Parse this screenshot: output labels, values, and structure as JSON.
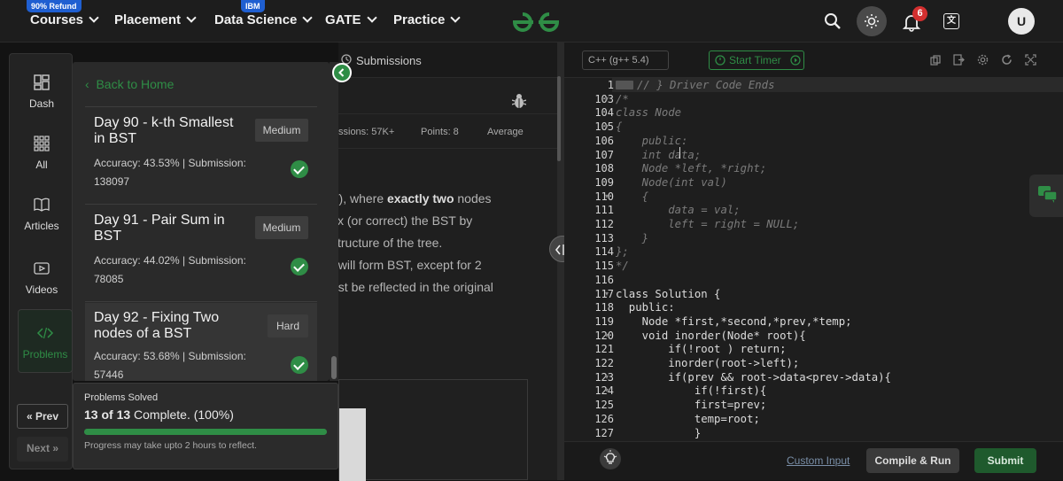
{
  "nav": {
    "courses": "Courses",
    "courses_badge": "90% Refund",
    "placement": "Placement",
    "data_science": "Data Science",
    "data_science_badge": "IBM",
    "gate": "GATE",
    "practice": "Practice",
    "notification_count": "6",
    "avatar_initial": "U"
  },
  "rail": {
    "items": [
      {
        "label": "Dash",
        "icon": "dashboard-icon"
      },
      {
        "label": "All",
        "icon": "grid-icon"
      },
      {
        "label": "Articles",
        "icon": "book-icon"
      },
      {
        "label": "Videos",
        "icon": "play-icon"
      },
      {
        "label": "Problems",
        "icon": "code-icon"
      }
    ],
    "prev": "Prev",
    "next": "Next"
  },
  "problem_list": {
    "back": "Back to Home",
    "cards": [
      {
        "title": "Day 90 - k-th Smallest in BST",
        "difficulty": "Medium",
        "stats_line1": "Accuracy: 43.53% | Submission:",
        "stats_line2": "138097"
      },
      {
        "title": "Day 91 - Pair Sum in BST",
        "difficulty": "Medium",
        "stats_line1": "Accuracy: 44.02% | Submission:",
        "stats_line2": "78085"
      },
      {
        "title": "Day 92 - Fixing Two nodes of a BST",
        "difficulty": "Hard",
        "stats_line1": "Accuracy: 53.68% | Submission:",
        "stats_line2": "57446"
      }
    ]
  },
  "progress": {
    "heading": "Problems Solved",
    "count": "13 of 13",
    "complete_text": "Complete. (100%)",
    "fraction": 1.0,
    "note": "Progress may take upto 2 hours to reflect."
  },
  "middle": {
    "submissions_tab": "Submissions",
    "stat_submissions": "ssions: 57K+",
    "stat_points": "Points: 8",
    "stat_average": "Average",
    "desc_lines": [
      "T), where exactly two nodes",
      "fix (or correct) the BST by",
      "structure of the tree.",
      "t will form BST, except for 2",
      "ust be reflected in the original"
    ],
    "bold_phrase": "exactly two"
  },
  "editor": {
    "language": "C++ (g++ 5.4)",
    "start_timer": "Start Timer",
    "custom_input": "Custom Input",
    "compile_run": "Compile & Run",
    "submit": "Submit",
    "lines": [
      {
        "n": "1",
        "code": "// } Driver Code Ends",
        "comment": true
      },
      {
        "n": "103",
        "code": "/*",
        "comment": true
      },
      {
        "n": "104",
        "code": "class Node",
        "comment": true
      },
      {
        "n": "105",
        "code": "{",
        "comment": true
      },
      {
        "n": "106",
        "code": "    public:",
        "comment": true
      },
      {
        "n": "107",
        "code": "    int data;",
        "comment": true
      },
      {
        "n": "108",
        "code": "    Node *left, *right;",
        "comment": true
      },
      {
        "n": "109",
        "code": "    Node(int val)",
        "comment": true
      },
      {
        "n": "110",
        "code": "    {",
        "comment": true
      },
      {
        "n": "111",
        "code": "        data = val;",
        "comment": true
      },
      {
        "n": "112",
        "code": "        left = right = NULL;",
        "comment": true
      },
      {
        "n": "113",
        "code": "    }",
        "comment": true
      },
      {
        "n": "114",
        "code": "};",
        "comment": true
      },
      {
        "n": "115",
        "code": "*/",
        "comment": true
      },
      {
        "n": "116",
        "code": "",
        "comment": false
      },
      {
        "n": "117",
        "code": "class Solution {",
        "comment": false
      },
      {
        "n": "118",
        "code": "  public:",
        "comment": false
      },
      {
        "n": "119",
        "code": "    Node *first,*second,*prev,*temp;",
        "comment": false
      },
      {
        "n": "120",
        "code": "    void inorder(Node* root){",
        "comment": false
      },
      {
        "n": "121",
        "code": "        if(!root ) return;",
        "comment": false
      },
      {
        "n": "122",
        "code": "        inorder(root->left);",
        "comment": false
      },
      {
        "n": "123",
        "code": "        if(prev && root->data<prev->data){",
        "comment": false
      },
      {
        "n": "124",
        "code": "            if(!first){",
        "comment": false
      },
      {
        "n": "125",
        "code": "            first=prev;",
        "comment": false
      },
      {
        "n": "126",
        "code": "            temp=root;",
        "comment": false
      },
      {
        "n": "127",
        "code": "            }",
        "comment": false
      }
    ]
  },
  "colors": {
    "accent_green": "#2f8d46",
    "badge_blue": "#1f5fd1",
    "notification_red": "#d32f2f"
  }
}
